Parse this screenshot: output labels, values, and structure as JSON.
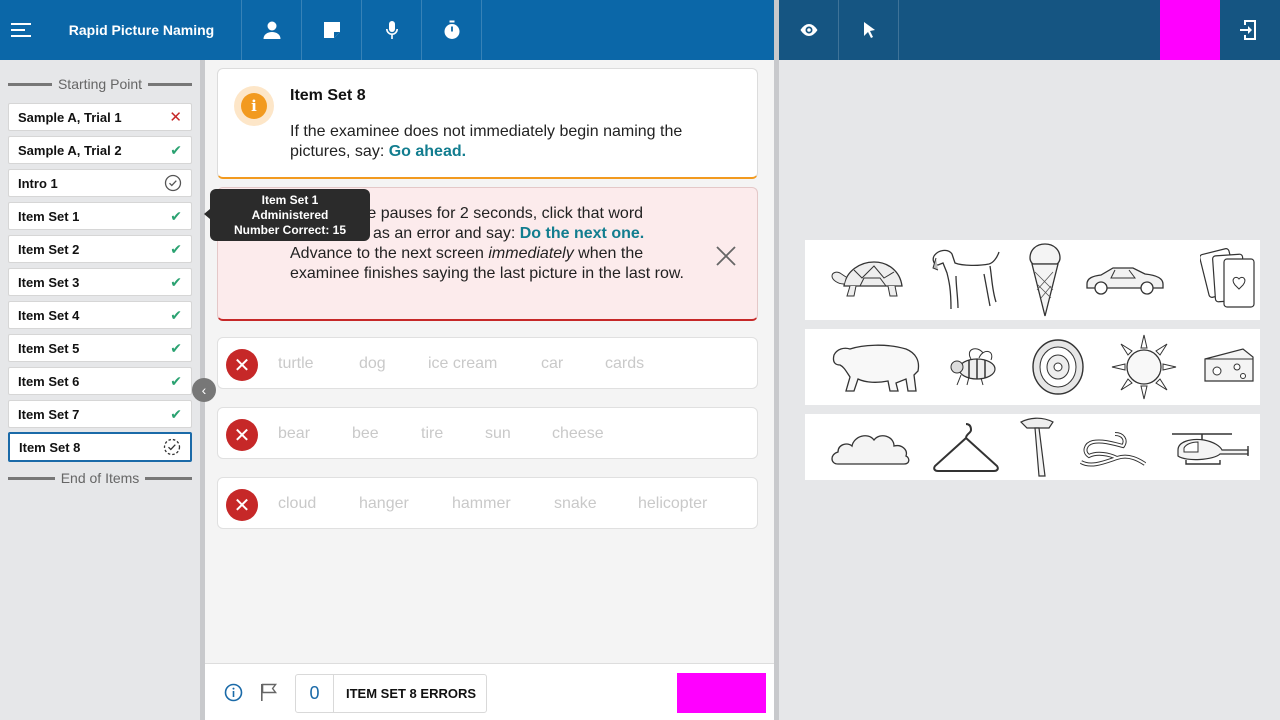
{
  "header": {
    "title": "Rapid Picture Naming",
    "icons": [
      "menu-icon",
      "person-icon",
      "note-icon",
      "microphone-icon",
      "timer-icon"
    ]
  },
  "right_toolbar": {
    "icons": [
      "eye-icon",
      "pointer-icon",
      "exit-icon"
    ],
    "accent_color": "#ff00ff"
  },
  "sidebar": {
    "start_label": "Starting Point",
    "end_label": "End of Items",
    "items": [
      {
        "label": "Sample A, Trial 1",
        "status": "incorrect"
      },
      {
        "label": "Sample A, Trial 2",
        "status": "complete"
      },
      {
        "label": "Intro 1",
        "status": "viewed"
      },
      {
        "label": "Item Set 1",
        "status": "complete"
      },
      {
        "label": "Item Set 2",
        "status": "complete"
      },
      {
        "label": "Item Set 3",
        "status": "complete"
      },
      {
        "label": "Item Set 4",
        "status": "complete"
      },
      {
        "label": "Item Set 5",
        "status": "complete"
      },
      {
        "label": "Item Set 6",
        "status": "complete"
      },
      {
        "label": "Item Set 7",
        "status": "complete"
      },
      {
        "label": "Item Set 8",
        "status": "in-progress"
      }
    ]
  },
  "tooltip": {
    "line1": "Item Set 1",
    "line2": "Administered",
    "line3": "Number Correct: 15"
  },
  "info_card": {
    "title": "Item Set 8",
    "text": "If the examinee does not immediately begin naming the pictures, say:",
    "prompt": "Go ahead."
  },
  "warn_card": {
    "text_a": "inee pauses for 2 seconds, click that word",
    "text_b": "as an error and say:",
    "prompt": "Do the next one.",
    "text_c": "Advance to the next screen",
    "text_c_em": "immediately",
    "text_c_end": "when the examinee finishes saying the last picture in the last row."
  },
  "rows": [
    {
      "words": [
        "turtle",
        "dog",
        "ice cream",
        "car",
        "cards"
      ]
    },
    {
      "words": [
        "bear",
        "bee",
        "tire",
        "sun",
        "cheese"
      ]
    },
    {
      "words": [
        "cloud",
        "hanger",
        "hammer",
        "snake",
        "helicopter"
      ]
    }
  ],
  "footer": {
    "error_count": "0",
    "errors_label": "ITEM SET 8 ERRORS"
  },
  "colors": {
    "header_blue": "#0b67a8",
    "right_header_blue": "#155582",
    "check_green": "#2aa271",
    "error_red": "#c62828",
    "teal_prompt": "#127d8f",
    "info_orange": "#f29a1f"
  }
}
